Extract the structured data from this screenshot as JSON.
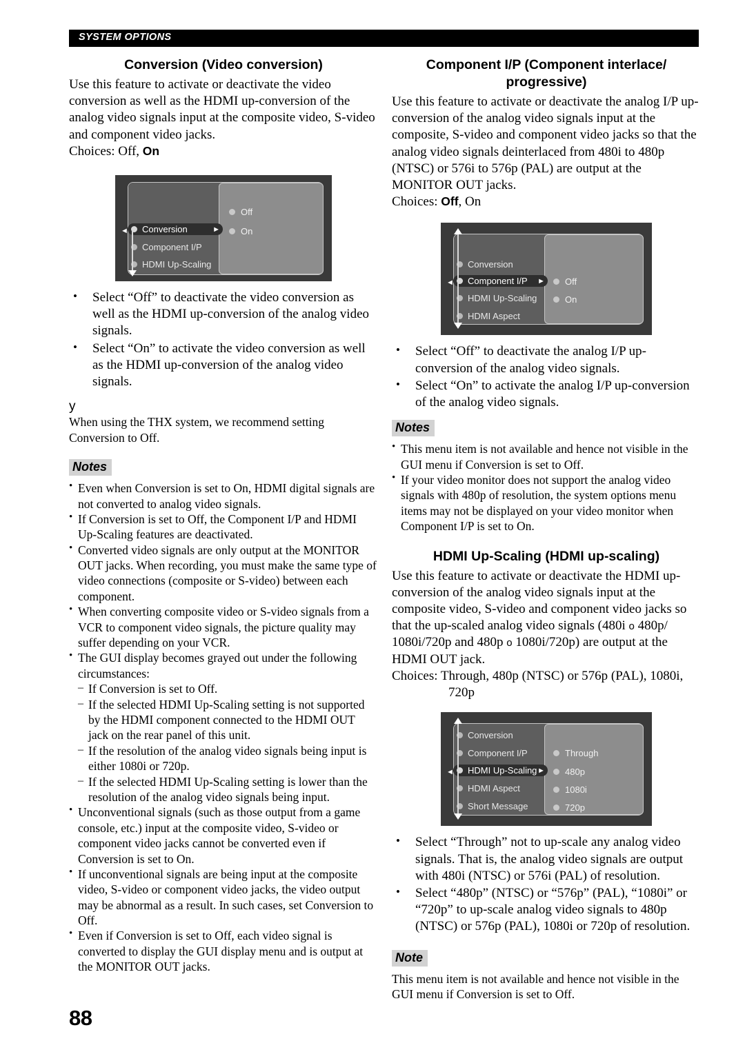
{
  "header": {
    "running_head": "SYSTEM OPTIONS"
  },
  "page_number": "88",
  "colors": {
    "header_bar": "#000000",
    "notes_badge": "#d2d2d2",
    "gui_outer": "#3a3a3a",
    "gui_left_panel": "#5e5e5e",
    "gui_right_panel": "#8d8d8d",
    "gui_selected_row": "#2e2e2e",
    "gui_border": "#c6c6c6"
  },
  "left_column": {
    "section": {
      "title": "Conversion (Video conversion)",
      "body": "Use this feature to activate or deactivate the video conversion as well as the HDMI up-conversion of the analog video signals input at the composite video, S-video and component video jacks.",
      "choices_label": "Choices:",
      "choices_plain": "Off,",
      "choices_bold": "On"
    },
    "gui": {
      "menu_items": [
        {
          "label": "Conversion",
          "selected": true
        },
        {
          "label": "Component I/P",
          "selected": false
        },
        {
          "label": "HDMI Up-Scaling",
          "selected": false
        }
      ],
      "options": [
        "Off",
        "On"
      ],
      "scroll_down_visible": true,
      "scroll_up_visible": false
    },
    "select_bullets": [
      "Select “Off” to deactivate the video conversion as well as the HDMI up-conversion of the analog video signals.",
      "Select “On” to activate the video conversion as well as the HDMI up-conversion of the analog video signals."
    ],
    "tip": {
      "marker": "y",
      "text": "When using the THX system, we recommend setting Conversion to Off."
    },
    "notes": {
      "badge": "Notes",
      "items": [
        {
          "text": "Even when Conversion is set to On, HDMI digital signals are not converted to analog video signals.",
          "sub": []
        },
        {
          "text": "If Conversion is set to Off, the Component I/P and HDMI Up-Scaling features are deactivated.",
          "sub": []
        },
        {
          "text": "Converted video signals are only output at the MONITOR OUT jacks. When recording, you must make the same type of video connections (composite or S-video) between each component.",
          "sub": []
        },
        {
          "text": "When converting composite video or S-video signals from a VCR to component video signals, the picture quality may suffer depending on your VCR.",
          "sub": []
        },
        {
          "text": "The GUI display becomes grayed out under the following circumstances:",
          "sub": [
            "If Conversion is set to Off.",
            "If the selected HDMI Up-Scaling setting is not supported by the HDMI component connected to the HDMI OUT jack on the rear panel of this unit.",
            "If the resolution of the analog video signals being input is either 1080i or 720p.",
            "If the selected HDMI Up-Scaling setting is lower than the resolution of the analog video signals being input."
          ]
        },
        {
          "text": "Unconventional signals (such as those output from a game console, etc.) input at the composite video, S-video or component video jacks cannot be converted even if Conversion is set to On.",
          "sub": []
        },
        {
          "text": "If unconventional signals are being input at the composite video, S-video or component video jacks, the video output may be abnormal as a result. In such cases, set Conversion to Off.",
          "sub": []
        },
        {
          "text": "Even if Conversion is set to Off, each video signal is converted to display the GUI display menu and is output at the MONITOR OUT jacks.",
          "sub": []
        }
      ]
    }
  },
  "right_column": {
    "section_component_ip": {
      "title": "Component I/P (Component interlace/ progressive)",
      "body": "Use this feature to activate or deactivate the analog I/P up-conversion of the analog video signals input at the composite, S-video and component video jacks so that the analog video signals deinterlaced from 480i to 480p (NTSC) or 576i to 576p (PAL) are output at the MONITOR OUT jacks.",
      "choices_label": "Choices:",
      "choices_bold": "Off",
      "choices_plain": ", On"
    },
    "gui_component_ip": {
      "menu_items": [
        {
          "label": "Conversion",
          "selected": false
        },
        {
          "label": "Component I/P",
          "selected": true
        },
        {
          "label": "HDMI Up-Scaling",
          "selected": false
        },
        {
          "label": "HDMI Aspect",
          "selected": false
        }
      ],
      "options": [
        "Off",
        "On"
      ],
      "scroll_up_visible": true,
      "scroll_down_visible": true
    },
    "select_bullets_component_ip": [
      "Select “Off” to deactivate the analog I/P up-conversion of the analog video signals.",
      "Select “On” to activate the analog I/P up-conversion of the analog video signals."
    ],
    "notes_component_ip": {
      "badge": "Notes",
      "items": [
        "This menu item is not available and hence not visible in the GUI menu if Conversion is set to Off.",
        "If your video monitor does not support the analog video signals with 480p of resolution, the system options menu items may not be displayed on your video monitor when Component I/P is set to On."
      ]
    },
    "section_hdmi_upscaling": {
      "title": "HDMI Up-Scaling (HDMI up-scaling)",
      "body_part1": "Use this feature to activate or deactivate the HDMI up-conversion of the analog video signals input at the composite video, S-video and component video jacks so that the up-scaled analog video signals (480i",
      "arrow_glyph": "o",
      "body_part2": "480p/ 1080i/720p and 480p",
      "body_part3": "1080i/720p) are output at the HDMI OUT jack.",
      "choices_label": "Choices: Through,",
      "choices_bold_1": "480p",
      "choices_mid": "(NTSC) or",
      "choices_bold_2": "576p",
      "choices_tail": "(PAL), 1080i, 720p"
    },
    "gui_hdmi_upscaling": {
      "menu_items": [
        {
          "label": "Conversion",
          "selected": false
        },
        {
          "label": "Component I/P",
          "selected": false
        },
        {
          "label": "HDMI Up-Scaling",
          "selected": true
        },
        {
          "label": "HDMI Aspect",
          "selected": false
        },
        {
          "label": "Short Message",
          "selected": false
        }
      ],
      "options": [
        "Through",
        "480p",
        "1080i",
        "720p"
      ],
      "scroll_up_visible": true,
      "scroll_down_visible": true
    },
    "select_bullets_hdmi": [
      "Select “Through” not to up-scale any analog video signals. That is, the analog video signals are output with 480i (NTSC) or 576i (PAL) of resolution.",
      "Select “480p” (NTSC) or “576p” (PAL), “1080i” or “720p” to up-scale analog video signals to 480p (NTSC) or 576p (PAL), 1080i or 720p of resolution."
    ],
    "note_hdmi": {
      "badge": "Note",
      "text": "This menu item is not available and hence not visible in the GUI menu if Conversion is set to Off."
    }
  }
}
